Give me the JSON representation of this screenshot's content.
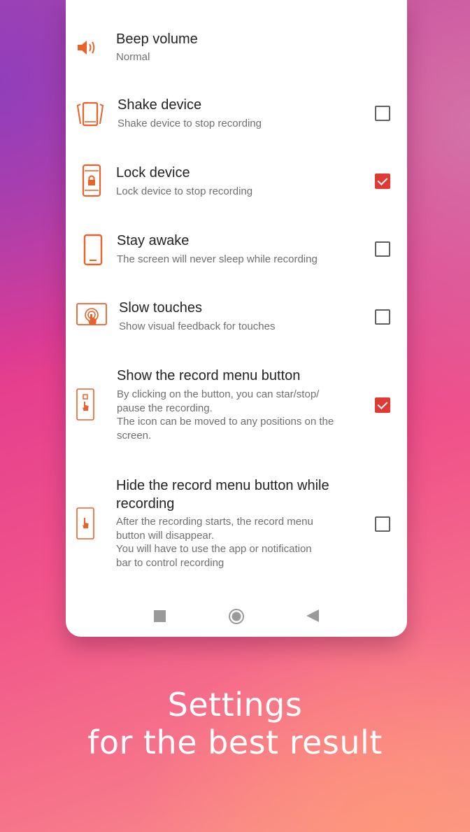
{
  "settings": [
    {
      "title": "Beep volume",
      "desc": "Normal",
      "icon": "speaker-icon",
      "checkbox": null
    },
    {
      "title": "Shake device",
      "desc": "Shake device to stop recording",
      "icon": "shake-device-icon",
      "checkbox": false
    },
    {
      "title": "Lock device",
      "desc": "Lock device to stop recording",
      "icon": "lock-device-icon",
      "checkbox": true
    },
    {
      "title": "Stay awake",
      "desc": "The screen will never sleep while recording",
      "icon": "phone-icon",
      "checkbox": false
    },
    {
      "title": "Slow touches",
      "desc": "Show visual feedback for touches",
      "icon": "touch-feedback-icon",
      "checkbox": false
    },
    {
      "title": "Show the record menu button",
      "desc_lines": [
        "By clicking on the button, you can star/stop/",
        "pause the recording.",
        "The icon can be moved to any positions on the",
        "screen."
      ],
      "icon": "record-menu-icon",
      "checkbox": true
    },
    {
      "title_lines": [
        "Hide the record menu button while",
        "recording"
      ],
      "desc_lines": [
        "After the recording starts, the record menu",
        "button will disappear.",
        "You will have to use the app or notification",
        "bar to control recording"
      ],
      "icon": "hide-record-menu-icon",
      "checkbox": false
    }
  ],
  "navbar": {
    "icons": [
      "recents-square-icon",
      "home-circle-icon",
      "back-triangle-icon"
    ]
  },
  "caption": {
    "line1": "Settings",
    "line2": "for the best result"
  },
  "colors": {
    "accent": "#e8622a",
    "checkbox_checked": "#e03a36"
  }
}
